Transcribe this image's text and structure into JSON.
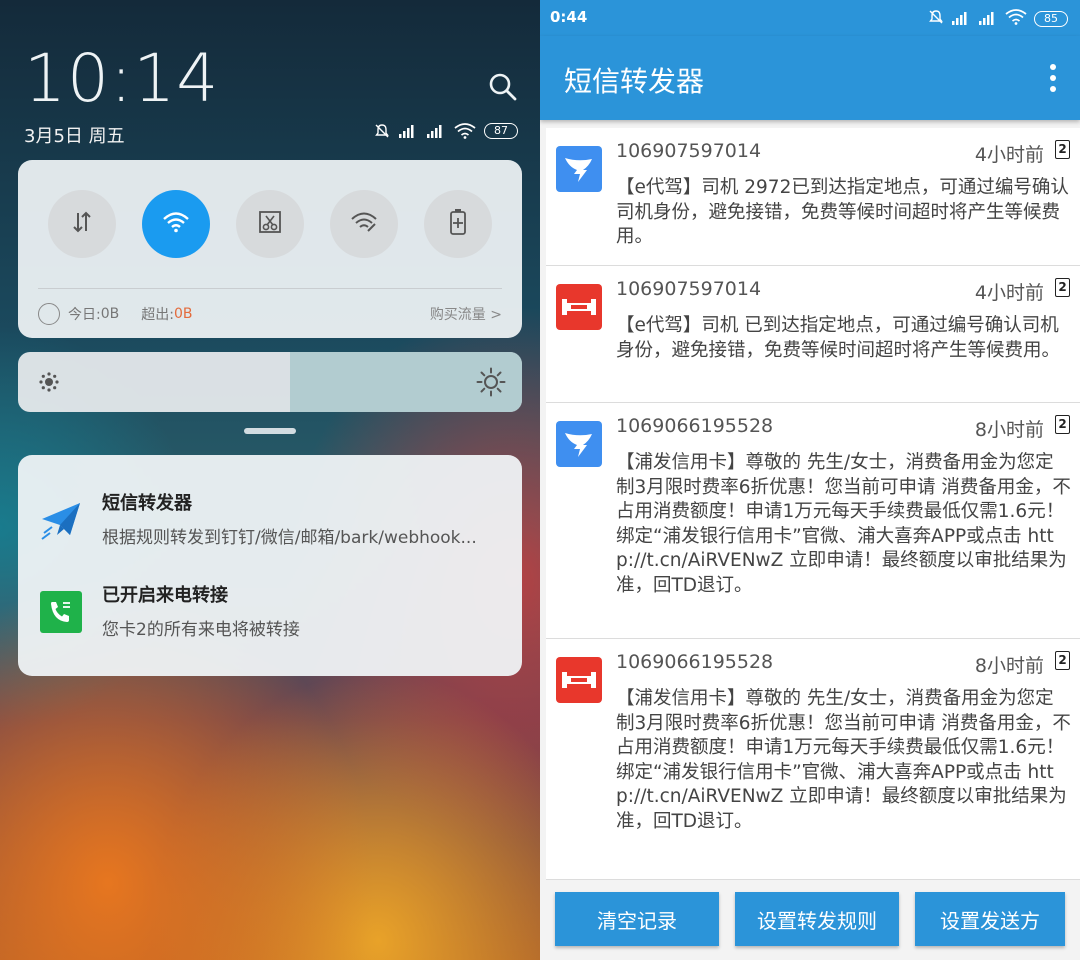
{
  "shade": {
    "time": "10:14",
    "date": "3月5日  周五",
    "battery": "87",
    "data_today_label": "今日:",
    "data_today_value": "0B",
    "data_over_label": "超出:",
    "data_over_value": "0B",
    "buy_data": "购买流量 >",
    "quick_settings": [
      "data-toggle-icon",
      "wifi-icon",
      "screenshot-icon",
      "wifi-hotspot-icon",
      "battery-saver-icon"
    ],
    "brightness_level": 0.54,
    "notifications": [
      {
        "icon": "paper-plane-icon",
        "title": "短信转发器",
        "body": "根据规则转发到钉钉/微信/邮箱/bark/webhook..."
      },
      {
        "icon": "phone-forward-icon",
        "title": "已开启来电转接",
        "body": "您卡2的所有来电将被转接"
      }
    ]
  },
  "app": {
    "status_time": "0:44",
    "battery": "85",
    "title": "短信转发器",
    "messages": [
      {
        "avatar": "dingtalk-icon",
        "sender": "106907597014",
        "time": "4小时前",
        "sim": "2",
        "text": "【e代驾】司机 2972已到达指定地点，可通过编号确认司机身份，避免接错，免费等候时间超时将产生等候费用。"
      },
      {
        "avatar": "dumbbell-icon",
        "sender": "106907597014",
        "time": "4小时前",
        "sim": "2",
        "text": "【e代驾】司机 已到达指定地点，可通过编号确认司机身份，避免接错，免费等候时间超时将产生等候费用。"
      },
      {
        "avatar": "dingtalk-icon",
        "sender": "1069066195528",
        "time": "8小时前",
        "sim": "2",
        "text": "【浦发信用卡】尊敬的 先生/女士，消费备用金为您定制3月限时费率6折优惠！您当前可申请 消费备用金，不占用消费额度！申请1万元每天手续费最低仅需1.6元！绑定“浦发银行信用卡”官微、浦大喜奔APP或点击 http://t.cn/AiRVENwZ 立即申请！最终额度以审批结果为准，回TD退订。"
      },
      {
        "avatar": "dumbbell-icon",
        "sender": "1069066195528",
        "time": "8小时前",
        "sim": "2",
        "text": "【浦发信用卡】尊敬的 先生/女士，消费备用金为您定制3月限时费率6折优惠！您当前可申请 消费备用金，不占用消费额度！申请1万元每天手续费最低仅需1.6元！绑定“浦发银行信用卡”官微、浦大喜奔APP或点击 http://t.cn/AiRVENwZ 立即申请！最终额度以审批结果为准，回TD退订。"
      }
    ],
    "buttons": {
      "clear": "清空记录",
      "rules": "设置转发规则",
      "sender": "设置发送方"
    },
    "colors": {
      "primary": "#2b94d9",
      "qs_active": "#1a9bf0",
      "dingtalk": "#3f8ff0",
      "dumbbell": "#e8372c"
    }
  }
}
